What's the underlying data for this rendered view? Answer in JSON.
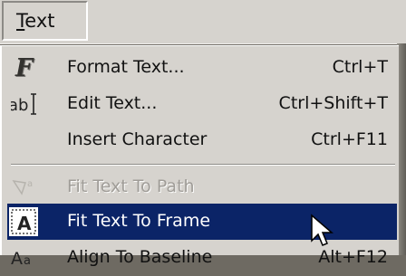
{
  "menubar": {
    "menu_text_first": "T",
    "menu_text_rest": "ext"
  },
  "menu": {
    "items": [
      {
        "label": "Format Text...",
        "shortcut": "Ctrl+T",
        "icon": "format-text-F-icon",
        "enabled": true
      },
      {
        "label": "Edit Text...",
        "shortcut": "Ctrl+Shift+T",
        "icon": "edit-text-ab-icon",
        "enabled": true
      },
      {
        "label": "Insert Character",
        "shortcut": "Ctrl+F11",
        "icon": "",
        "enabled": true
      },
      {
        "label": "Fit Text To Path",
        "shortcut": "",
        "icon": "fit-text-to-path-icon",
        "enabled": false
      },
      {
        "label": "Fit Text To Frame",
        "shortcut": "",
        "icon": "fit-text-to-frame-icon",
        "enabled": true,
        "selected": true
      },
      {
        "label": "Align To Baseline",
        "shortcut": "Alt+F12",
        "icon": "align-to-baseline-icon",
        "enabled": true
      }
    ]
  },
  "colors": {
    "menu_background": "#d6d3ce",
    "highlight": "#0b2467",
    "disabled_text": "#a09d98"
  }
}
